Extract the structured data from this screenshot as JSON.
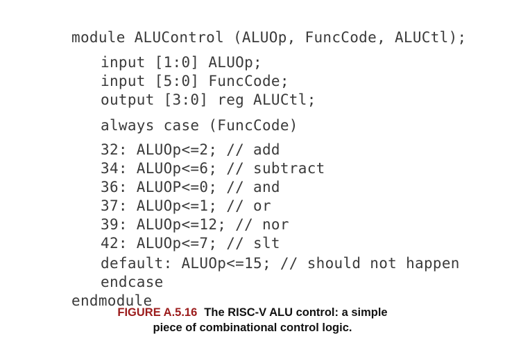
{
  "code": {
    "lines": [
      "module ALUControl (ALUOp, FuncCode, ALUCtl);",
      "input [1:0] ALUOp;",
      "input [5:0] FuncCode;",
      "output [3:0] reg ALUCtl;",
      "always case (FuncCode)",
      "32: ALUOp<=2; // add",
      "34: ALUOp<=6; // subtract",
      "36: ALUOP<=0; // and",
      "37: ALUOp<=1; // or",
      "39: ALUOp<=12; // nor",
      "42: ALUOp<=7; // slt",
      "default: ALUOp<=15; // should not happen",
      "endcase",
      "endmodule"
    ]
  },
  "caption": {
    "label": "FIGURE A.5.16",
    "line1": "The RISC-V ALU control: a simple",
    "line2": "piece of combinational control logic."
  },
  "colors": {
    "code_text": "#3a3a3a",
    "figure_label": "#9b1b1b",
    "caption_text": "#111111",
    "background": "#ffffff"
  }
}
